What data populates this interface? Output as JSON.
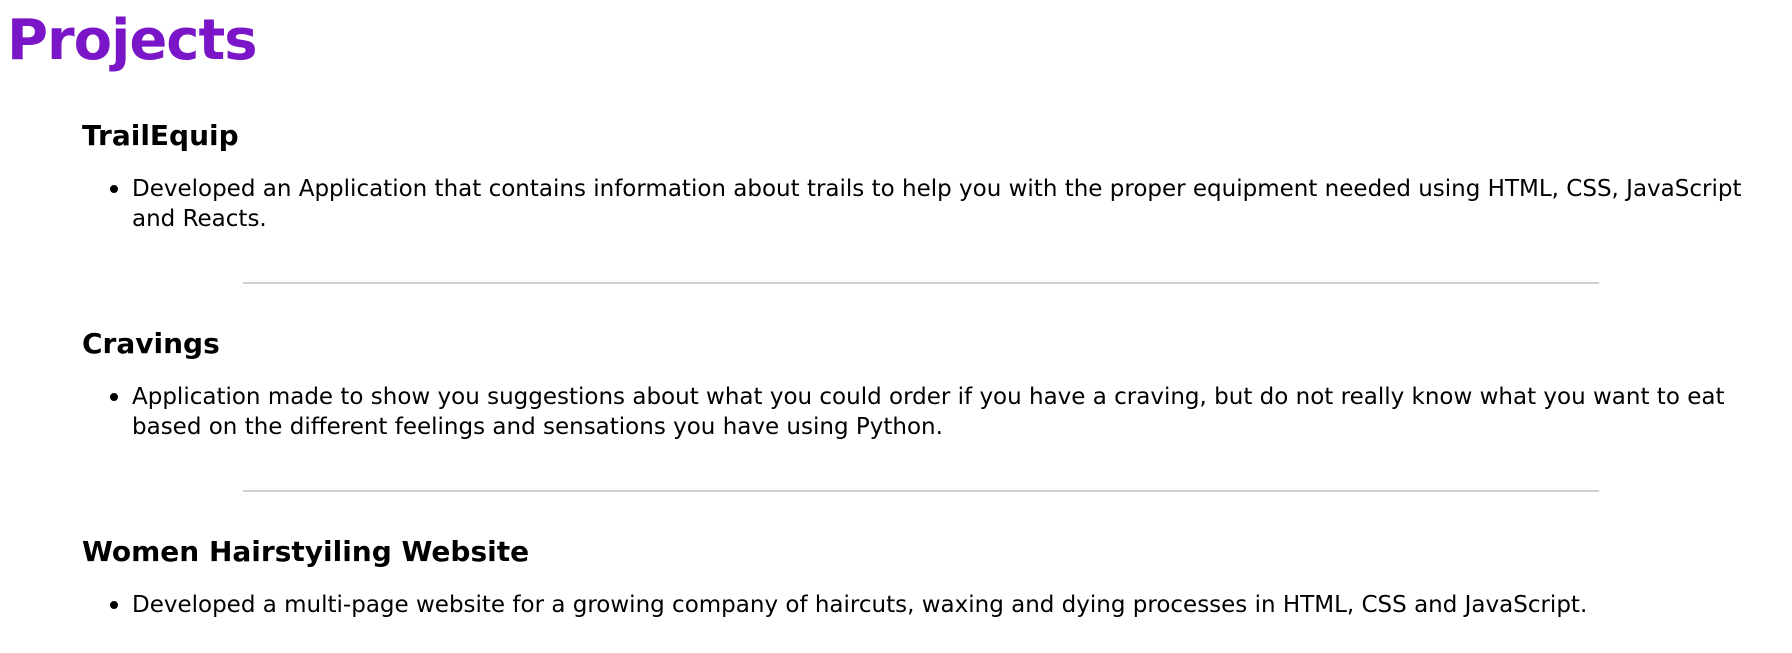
{
  "page": {
    "title": "Projects",
    "title_color": "#7a16c8",
    "divider_color": "#d0d0d0"
  },
  "projects": [
    {
      "name": "TrailEquip",
      "description": "Developed an Application that contains information about trails to help you with the proper equipment needed using HTML, CSS, JavaScript and Reacts."
    },
    {
      "name": "Cravings",
      "description": "Application made to show you suggestions about what you could order if you have a craving, but do not really know what you want to eat based on the different feelings and sensations you have using Python."
    },
    {
      "name": "Women Hairstyiling Website",
      "description": "Developed a multi-page website for a growing company of haircuts, waxing and dying processes in HTML, CSS and JavaScript."
    }
  ]
}
